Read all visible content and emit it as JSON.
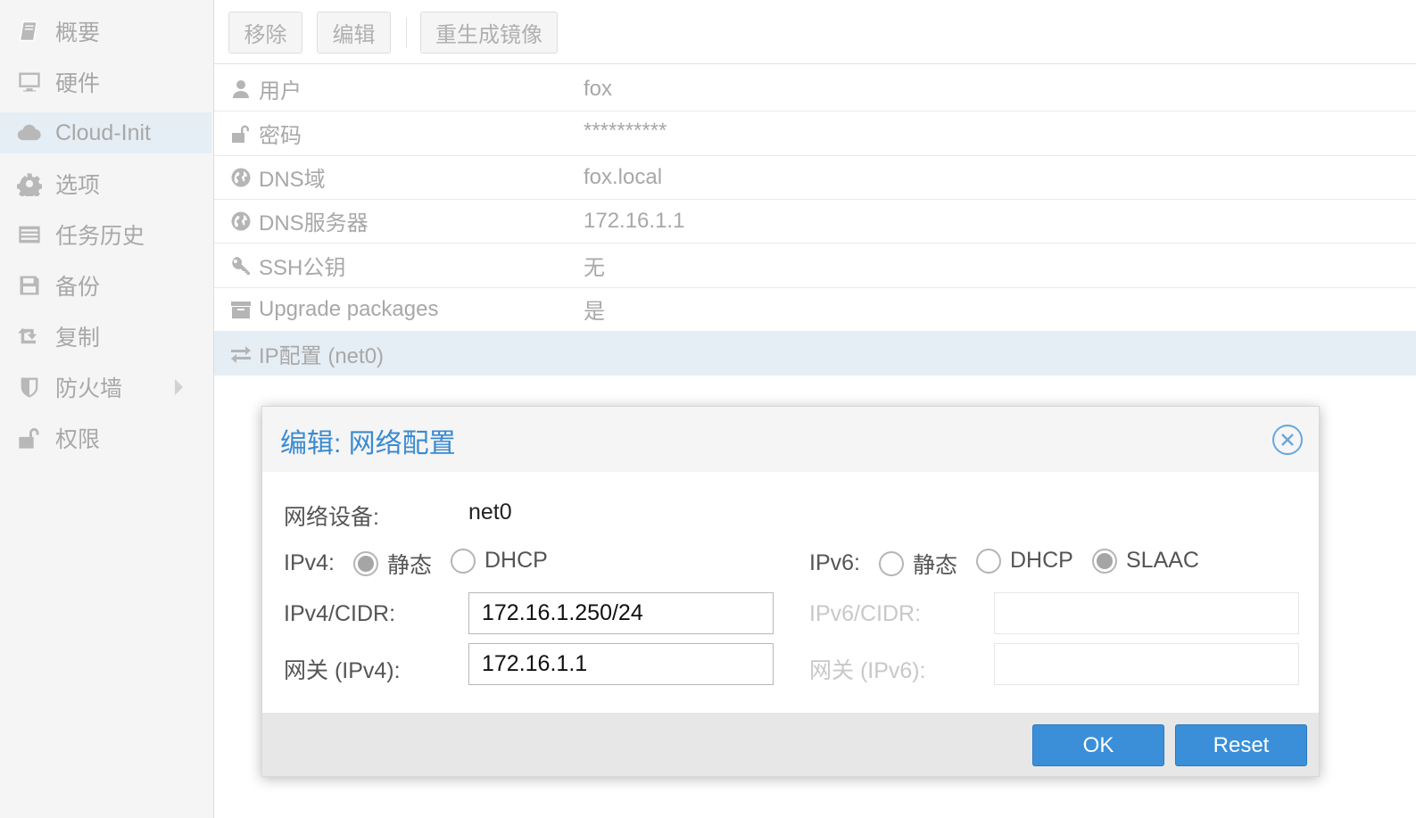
{
  "sidebar": {
    "items": [
      {
        "label": "概要",
        "icon": "book-icon",
        "active": false
      },
      {
        "label": "硬件",
        "icon": "monitor-icon",
        "active": false
      },
      {
        "label": "Cloud-Init",
        "icon": "cloud-icon",
        "active": true
      },
      {
        "label": "选项",
        "icon": "gear-icon",
        "active": false
      },
      {
        "label": "任务历史",
        "icon": "list-icon",
        "active": false
      },
      {
        "label": "备份",
        "icon": "floppy-icon",
        "active": false
      },
      {
        "label": "复制",
        "icon": "retweet-icon",
        "active": false
      },
      {
        "label": "防火墙",
        "icon": "shield-icon",
        "active": false
      },
      {
        "label": "权限",
        "icon": "unlock-icon",
        "active": false
      }
    ]
  },
  "toolbar": {
    "remove_label": "移除",
    "edit_label": "编辑",
    "regenerate_label": "重生成镜像"
  },
  "properties": [
    {
      "key": "用户",
      "value": "fox",
      "icon": "user-icon"
    },
    {
      "key": "密码",
      "value": "**********",
      "icon": "unlock-icon"
    },
    {
      "key": "DNS域",
      "value": "fox.local",
      "icon": "globe-icon"
    },
    {
      "key": "DNS服务器",
      "value": "172.16.1.1",
      "icon": "globe-icon"
    },
    {
      "key": "SSH公钥",
      "value": "无",
      "icon": "key-icon"
    },
    {
      "key": "Upgrade packages",
      "value": "是",
      "icon": "archive-icon"
    },
    {
      "key": "IP配置 (net0)",
      "value": "",
      "icon": "exchange-icon"
    }
  ],
  "dialog": {
    "title": "编辑: 网络配置",
    "device_label": "网络设备:",
    "device_value": "net0",
    "ipv4_label": "IPv4:",
    "ipv4_options": [
      "静态",
      "DHCP"
    ],
    "ipv4_selected": "静态",
    "ipv6_label": "IPv6:",
    "ipv6_options": [
      "静态",
      "DHCP",
      "SLAAC"
    ],
    "ipv6_selected": "SLAAC",
    "ipv4_cidr_label": "IPv4/CIDR:",
    "ipv4_cidr_value": "172.16.1.250/24",
    "ipv4_gw_label": "网关 (IPv4):",
    "ipv4_gw_value": "172.16.1.1",
    "ipv6_cidr_label": "IPv6/CIDR:",
    "ipv6_cidr_value": "",
    "ipv6_gw_label": "网关 (IPv6):",
    "ipv6_gw_value": "",
    "ok_label": "OK",
    "reset_label": "Reset"
  },
  "colors": {
    "accent": "#3a8fd8",
    "title": "#3a8ad0",
    "selected_row": "#e6eef5"
  }
}
